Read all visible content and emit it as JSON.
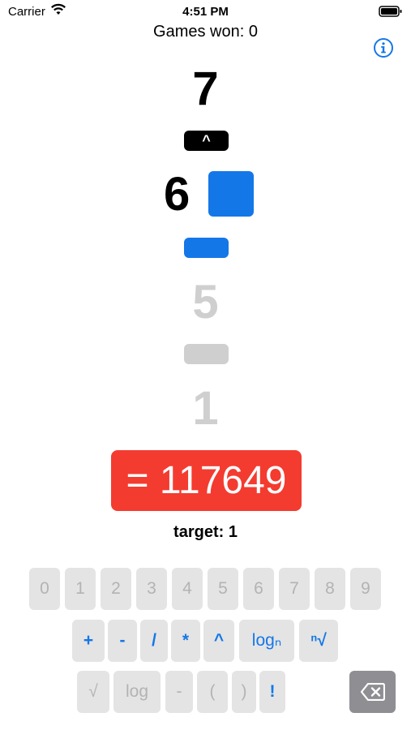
{
  "status_bar": {
    "carrier": "Carrier",
    "time": "4:51 PM"
  },
  "header": {
    "games_won": "Games won: 0"
  },
  "stack": {
    "n1": "7",
    "op1": "^",
    "n2": "6",
    "op2": "",
    "n3": "5",
    "op3": "",
    "n4": "1"
  },
  "result": {
    "text": "= 117649",
    "color": "#f43b30"
  },
  "target": "target:  1",
  "keypad": {
    "digits": [
      "0",
      "1",
      "2",
      "3",
      "4",
      "5",
      "6",
      "7",
      "8",
      "9"
    ],
    "ops_row": [
      "+",
      "-",
      "/",
      "*",
      "^",
      "logₙ",
      "ⁿ√"
    ],
    "bottom_row": [
      "√",
      "log",
      "-",
      "(",
      ")",
      "!"
    ],
    "backspace_icon": "backspace-icon"
  },
  "colors": {
    "accent": "#1477e8",
    "operator_selected": "#000000",
    "result_bg": "#f43b30"
  }
}
